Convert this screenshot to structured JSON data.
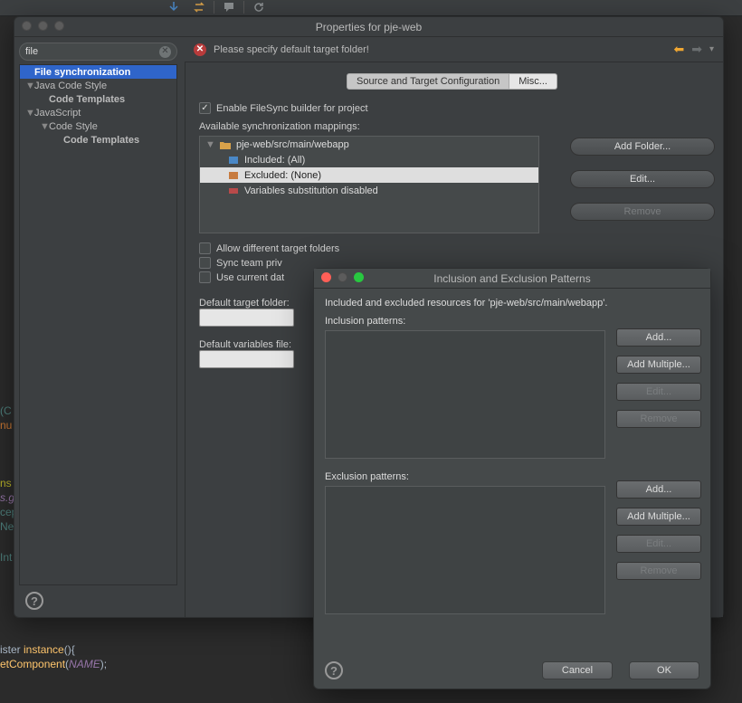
{
  "top_toolbar": {
    "icons": [
      "sync-down-icon",
      "sync-swap-icon",
      "speech-icon",
      "refresh-icon"
    ]
  },
  "code_editor": {
    "snip1": [
      "(C",
      "nu"
    ],
    "snip2": [
      "ns",
      "s.ge",
      "cep",
      "Ner"
    ],
    "snip3": [
      "Int"
    ],
    "snip4_parts": {
      "l1a": "ister ",
      "l1b": "instance",
      "l1c": "(){",
      "l2a": "etComponent",
      "l2b": "(",
      "l2c": "NAME",
      "l2d": ");"
    }
  },
  "filter": {
    "value": "file"
  },
  "tree": [
    {
      "label": "File synchronization",
      "indent": 0,
      "selected": true,
      "twisty": ""
    },
    {
      "label": "Java Code Style",
      "indent": 0,
      "twisty": "▼"
    },
    {
      "label": "Code Templates",
      "indent": 1,
      "bold": true
    },
    {
      "label": "JavaScript",
      "indent": 0,
      "twisty": "▼"
    },
    {
      "label": "Code Style",
      "indent": 1,
      "twisty": "▼"
    },
    {
      "label": "Code Templates",
      "indent": 2,
      "bold": true
    }
  ],
  "properties": {
    "title": "Properties for pje-web",
    "banner_text": "Please specify default target folder!",
    "tabs": {
      "first": "Source and Target Configuration",
      "second": "Misc..."
    },
    "enable_label": "Enable FileSync builder for project",
    "mappings_label": "Available synchronization mappings:",
    "mapping_rows": [
      {
        "text": "pje-web/src/main/webapp",
        "twisty": "▼",
        "icon": "folder-open-icon"
      },
      {
        "text": "Included: (All)",
        "icon": "include-icon"
      },
      {
        "text": "Excluded: (None)",
        "icon": "exclude-icon",
        "selected": true
      },
      {
        "text": "Variables substitution disabled",
        "icon": "vars-off-icon"
      }
    ],
    "side_buttons": {
      "add_folder": "Add Folder...",
      "edit": "Edit...",
      "remove": "Remove"
    },
    "checks": {
      "diff_targets": "Allow different target folders",
      "team_shared": "Sync team priv",
      "use_current": "Use current dat"
    },
    "fields": {
      "default_target_label": "Default target folder:",
      "default_vars_label": "Default variables file:"
    }
  },
  "inner_dialog": {
    "title": "Inclusion and Exclusion Patterns",
    "subtitle": "Included and excluded resources for 'pje-web/src/main/webapp'.",
    "inclusion_label": "Inclusion patterns:",
    "exclusion_label": "Exclusion patterns:",
    "buttons": {
      "add": "Add...",
      "add_multiple": "Add Multiple...",
      "edit": "Edit...",
      "remove": "Remove",
      "cancel": "Cancel",
      "ok": "OK"
    }
  }
}
